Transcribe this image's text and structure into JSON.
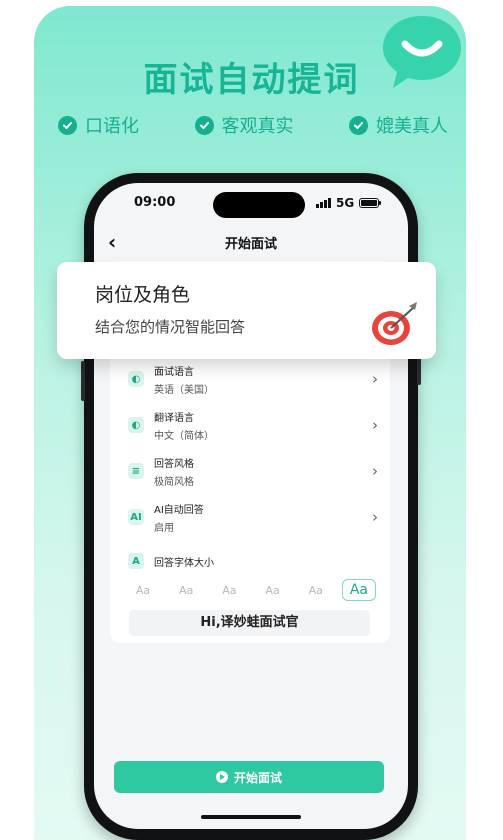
{
  "headline": "面试自动提词",
  "features": [
    {
      "label": "口语化",
      "icon": "check-circle-icon"
    },
    {
      "label": "客观真实",
      "icon": "check-circle-icon"
    },
    {
      "label": "媲美真人",
      "icon": "check-circle-icon"
    }
  ],
  "status_bar": {
    "time": "09:00",
    "network": "5G"
  },
  "nav": {
    "title": "开始面试",
    "back_icon": "chevron-left-icon"
  },
  "role_card": {
    "title": "岗位及角色",
    "subtitle": "结合您的情况智能回答",
    "icon": "target-dart-icon"
  },
  "settings": [
    {
      "title": "面试语言",
      "value": "英语（美国）",
      "icon": "globe-icon"
    },
    {
      "title": "翻译语言",
      "value": "中文（简体）",
      "icon": "globe-icon"
    },
    {
      "title": "回答风格",
      "value": "极简风格",
      "icon": "align-left-icon"
    },
    {
      "title": "AI自动回答",
      "value": "启用",
      "icon": "ai-icon"
    }
  ],
  "font_size": {
    "title": "回答字体大小",
    "icon": "font-size-icon",
    "options": [
      "Aa",
      "Aa",
      "Aa",
      "Aa",
      "Aa",
      "Aa"
    ],
    "selected_index": 5,
    "preview": "Hi,译妙蛙面试官"
  },
  "start_button": {
    "label": "开始面试",
    "icon": "play-icon"
  },
  "colors": {
    "accent": "#2ec9a0",
    "headline": "#18b594",
    "background_top": "#7fe8cf"
  }
}
